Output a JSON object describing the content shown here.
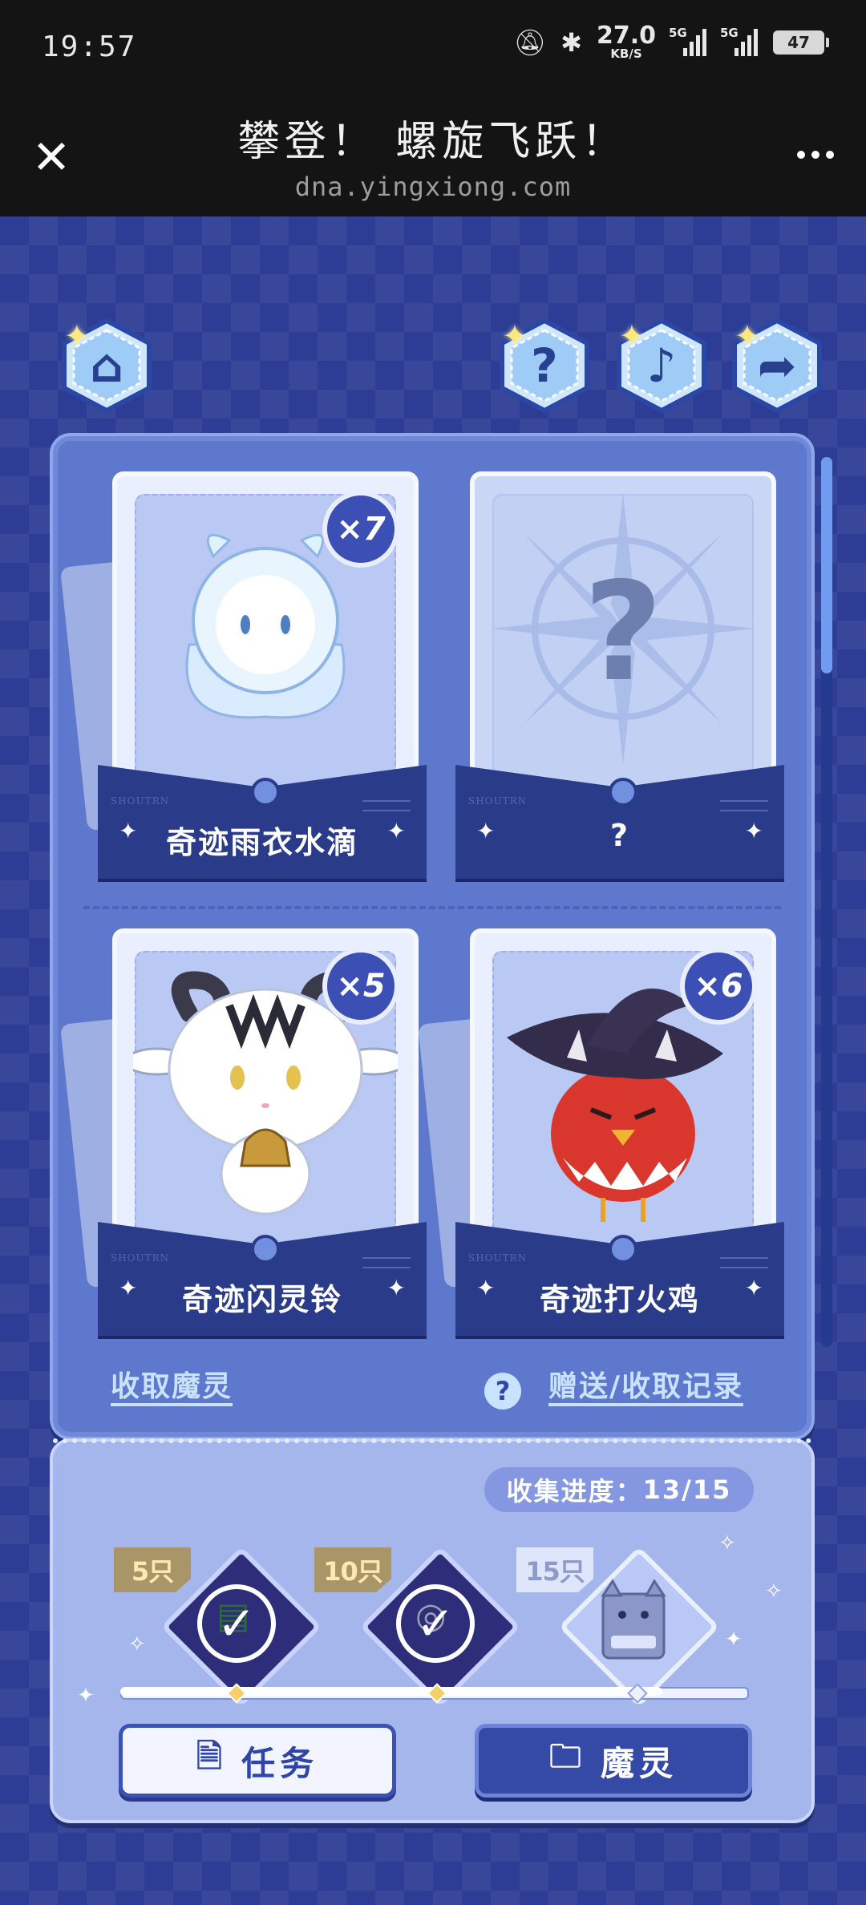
{
  "status_bar": {
    "time": "19:57",
    "network_speed": "27.0",
    "network_unit": "KB/S",
    "signal_1_label": "5G",
    "signal_2_label": "5G",
    "battery": "47",
    "icons": [
      "mute-bell-icon",
      "bluetooth-icon"
    ]
  },
  "header": {
    "title": "攀登！ 螺旋飞跃！",
    "url": "dna.yingxiong.com"
  },
  "nav": {
    "icons": [
      "home-icon",
      "help-icon",
      "music-icon",
      "share-icon"
    ]
  },
  "cards": [
    {
      "name": "奇迹雨衣水滴",
      "count": "×7",
      "owned": true
    },
    {
      "name": "?",
      "count": "",
      "owned": false,
      "placeholder": "?"
    },
    {
      "name": "奇迹闪灵铃",
      "count": "×5",
      "owned": true
    },
    {
      "name": "奇迹打火鸡",
      "count": "×6",
      "owned": true
    }
  ],
  "links": {
    "collect": "收取魔灵",
    "records": "赠送/收取记录",
    "help_glyph": "?"
  },
  "progress": {
    "label": "收集进度：",
    "value": "13/15",
    "current": 13,
    "total": 15,
    "milestones": [
      {
        "tag": "5只",
        "completed": true
      },
      {
        "tag": "10只",
        "completed": true
      },
      {
        "tag": "15只",
        "completed": false
      }
    ]
  },
  "buttons": {
    "task": "任务",
    "spirit": "魔灵"
  },
  "colors": {
    "background": "#2d3d95",
    "panel": "#5d78cc",
    "accent": "#c8e2ff",
    "nameplate": "#2a3b89"
  }
}
